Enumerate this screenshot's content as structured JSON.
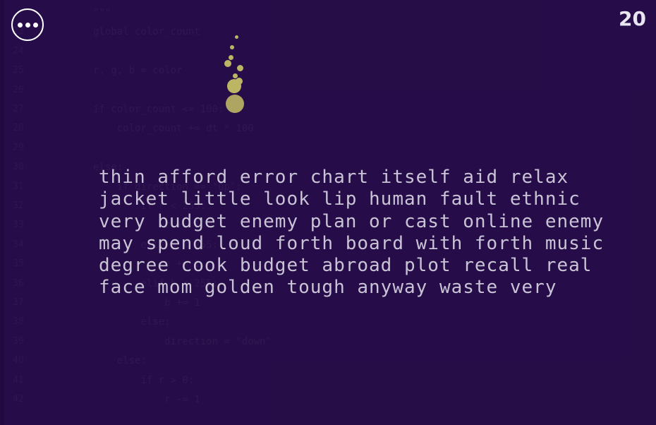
{
  "score": "20",
  "menu": {
    "icon": "more-horizontal-icon"
  },
  "words_lines": [
    "thin afford error chart itself aid relax",
    "jacket little look lip human fault ethnic",
    "very budget enemy plan or cast online enemy",
    "may spend loud forth board with forth music",
    "degree cook budget abroad plot recall real",
    "face mom golden tough anyway waste very"
  ],
  "code_lines": [
    {
      "n": "",
      "t": "\"\"\""
    },
    {
      "n": "23",
      "t": "global color_count"
    },
    {
      "n": "24",
      "t": ""
    },
    {
      "n": "25",
      "t": "r, g, b = color"
    },
    {
      "n": "26",
      "t": ""
    },
    {
      "n": "27",
      "t": "if color_count <= 100:"
    },
    {
      "n": "28",
      "t": "    color_count += dt * 100"
    },
    {
      "n": "29",
      "t": ""
    },
    {
      "n": "30",
      "t": "else:"
    },
    {
      "n": "31",
      "t": "    if direction == \"up\":"
    },
    {
      "n": "32",
      "t": "        if r < 255:"
    },
    {
      "n": "33",
      "t": "            r += 1"
    },
    {
      "n": "34",
      "t": "        elif g < 255:"
    },
    {
      "n": "35",
      "t": "            g += 1"
    },
    {
      "n": "36",
      "t": "        elif b < 255:"
    },
    {
      "n": "37",
      "t": "            b += 1"
    },
    {
      "n": "38",
      "t": "        else:"
    },
    {
      "n": "39",
      "t": "            direction = \"down\""
    },
    {
      "n": "40",
      "t": "    else:"
    },
    {
      "n": "41",
      "t": "        if r > 0:"
    },
    {
      "n": "42",
      "t": "            r -= 1"
    }
  ],
  "colors": {
    "background": "#2a0f4a",
    "text": "#c9c3d6",
    "particle": "#bcb664",
    "score": "#e8e6f0"
  }
}
